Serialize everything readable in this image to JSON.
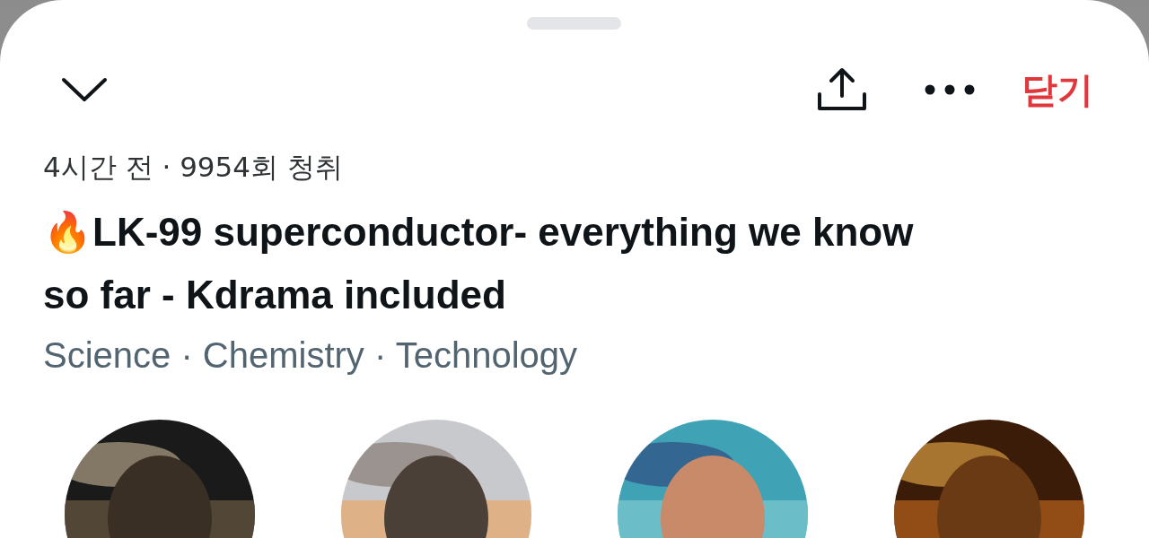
{
  "header": {
    "close_label": "닫기"
  },
  "meta": "4시간 전 · 9954회 청취",
  "title": {
    "emoji": "🔥",
    "text": "LK-99 superconductor- everything we know so far - Kdrama included"
  },
  "topics": "Science · Chemistry · Technology"
}
